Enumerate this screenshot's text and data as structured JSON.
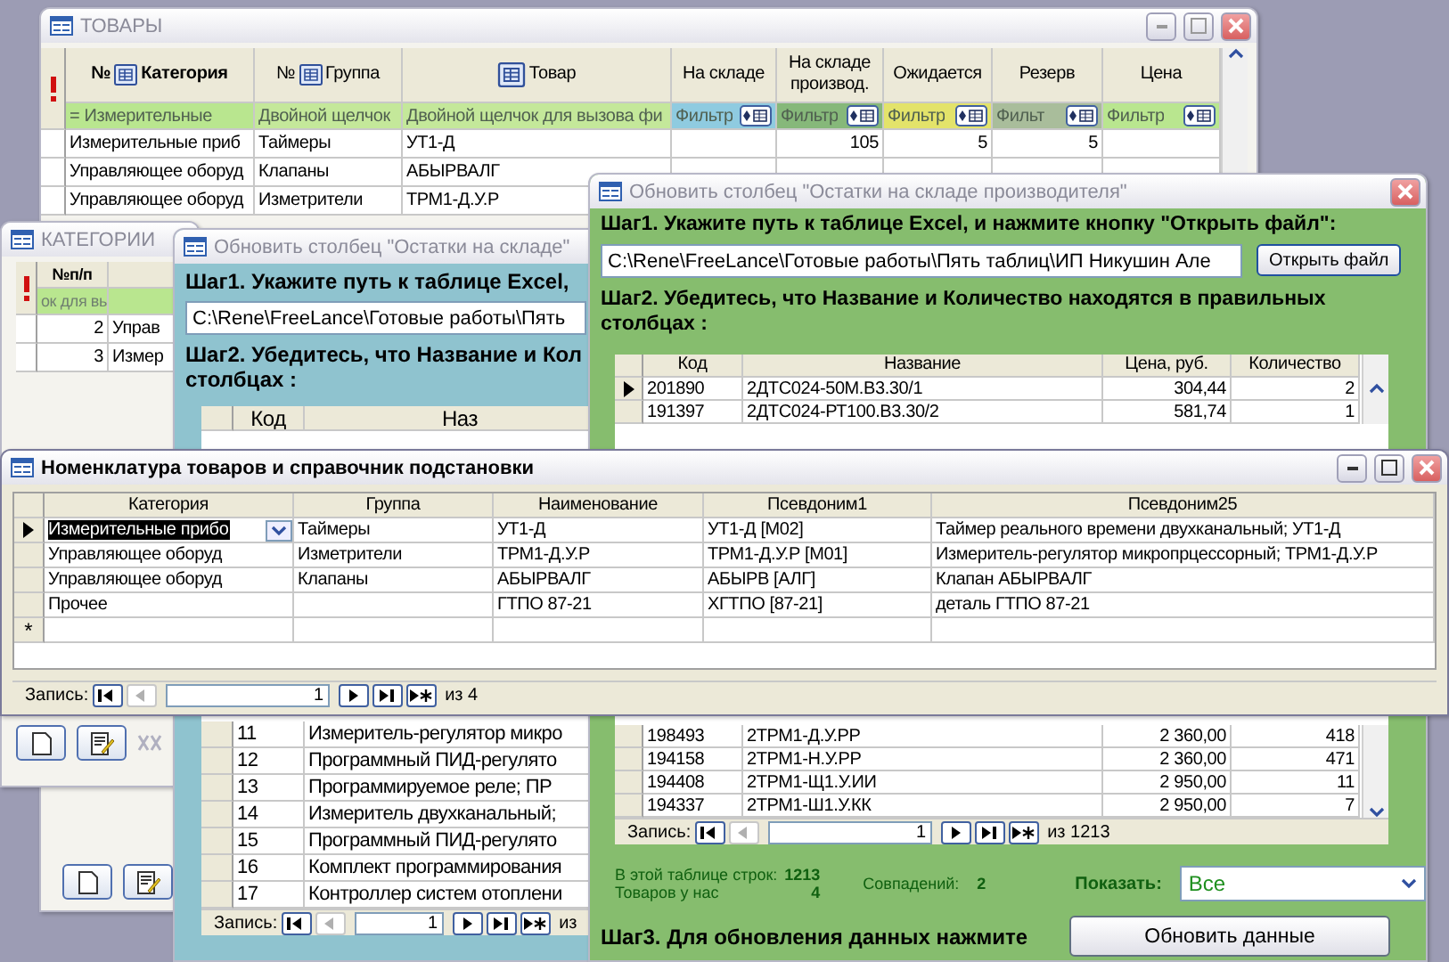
{
  "products_window": {
    "title": "ТОВАРЫ",
    "columns": [
      {
        "label": "Категория",
        "number_mark": "№",
        "bold": true,
        "filter": "= Измерительные",
        "color": "#b9e68f",
        "filter_button": false
      },
      {
        "label": "Группа",
        "number_mark": "№",
        "bold": false,
        "filter": "Двойной щелчок",
        "color": "#c4e89a",
        "filter_button": false
      },
      {
        "label": "Товар",
        "bold": false,
        "filter": "Двойной щелчок для вызова фи",
        "color": "#c4e89a",
        "filter_button": false
      },
      {
        "label": "На складе",
        "bold": false,
        "filter": "Фильтр",
        "color": "#8fcbe0",
        "filter_button": true
      },
      {
        "label": "На складе производ.",
        "bold": false,
        "filter": "Фильтр",
        "color": "#86b87a",
        "filter_button": true
      },
      {
        "label": "Ожидается",
        "bold": false,
        "filter": "Фильтр",
        "color": "#e3e36a",
        "filter_button": true
      },
      {
        "label": "Резерв",
        "bold": false,
        "filter": "Фильт",
        "color": "#a9bd9b",
        "filter_button": true
      },
      {
        "label": "Цена",
        "bold": false,
        "filter": "Фильтр",
        "color": "#b9e68f",
        "filter_button": true
      }
    ],
    "rows": [
      {
        "cells": [
          "Измерительные приб",
          "Таймеры",
          "УТ1-Д",
          null,
          "105",
          "5",
          "5",
          null
        ]
      },
      {
        "cells": [
          "Управляющее оборуд",
          "Клапаны",
          "АБЫРВАЛГ",
          null,
          null,
          null,
          null,
          null
        ]
      },
      {
        "cells": [
          "Управляющее оборуд",
          "Изметрители",
          "ТРМ1-Д.У.Р",
          null,
          null,
          null,
          null,
          null
        ]
      }
    ]
  },
  "categories_window": {
    "title": "КАТЕГОРИИ",
    "column": "№п/п",
    "filter": "ок для вь",
    "rows": [
      {
        "number": "2",
        "name": "Управ"
      },
      {
        "number": "3",
        "name": "Измер"
      }
    ]
  },
  "update_window_back": {
    "title": "Обновить столбец \"Остатки на складе\"",
    "step1": "Шаг1. Укажите путь к таблице Excel,",
    "path": "C:\\Rene\\FreeLance\\Готовые работы\\Пять",
    "step2_line1": "Шаг2. Убедитесь, что Название и Кол",
    "step2_line2": "столбцах :",
    "columns": [
      "Код",
      "Наз"
    ],
    "rows": [
      {
        "code": "11",
        "name": "Измеритель-регулятор микро"
      },
      {
        "code": "12",
        "name": "Программный ПИД-регулято"
      },
      {
        "code": "13",
        "name": "Программируемое реле; ПР"
      },
      {
        "code": "14",
        "name": "Измеритель двухканальный;"
      },
      {
        "code": "15",
        "name": "Программный ПИД-регулято"
      },
      {
        "code": "16",
        "name": "Комплект программирования"
      },
      {
        "code": "17",
        "name": "Контроллер систем отоплени"
      }
    ],
    "nav": {
      "label": "Запись:",
      "record": "1",
      "total": "из"
    }
  },
  "update_window": {
    "title": "Обновить столбец \"Остатки на складе производителя\"",
    "step1": "Шаг1. Укажите путь к таблице Excel, и нажмите кнопку \"Открыть файл\":",
    "path": "C:\\Rene\\FreeLance\\Готовые работы\\Пять таблиц\\ИП Никушин Але",
    "open_button": "Открыть файл",
    "step2": "Шаг2. Убедитесь, что Название и Количество находятся в правильных столбцах :",
    "columns": [
      "Код",
      "Название",
      "Цена, руб.",
      "Количество"
    ],
    "rows_top": [
      {
        "code": "201890",
        "name": "2ДТС024-50М.В3.30/1",
        "price": "304,44",
        "quantity": "2",
        "selected": true
      },
      {
        "code": "191397",
        "name": "2ДТС024-РТ100.В3.30/2",
        "price": "581,74",
        "quantity": "1",
        "selected": false
      }
    ],
    "rows_bottom": [
      {
        "code": "198493",
        "name": "2ТРМ1-Д.У.РР",
        "price": "2 360,00",
        "quantity": "418",
        "selected": false
      },
      {
        "code": "194158",
        "name": "2ТРМ1-Н.У.РР",
        "price": "2 360,00",
        "quantity": "471",
        "selected": false
      },
      {
        "code": "194408",
        "name": "2ТРМ1-Щ1.У.ИИ",
        "price": "2 950,00",
        "quantity": "11",
        "selected": false
      },
      {
        "code": "194337",
        "name": "2ТРМ1-Ш1.У.КК",
        "price": "2 950,00",
        "quantity": "7",
        "selected": false
      }
    ],
    "nav": {
      "label": "Запись:",
      "record": "1",
      "total": "из 1213"
    },
    "rows_label": "В этой таблице строк:",
    "rows_value": "1213",
    "ours_label": "Товаров у нас",
    "ours_value": "4",
    "matches_label": "Совпадений:",
    "matches_value": "2",
    "show_label": "Показать:",
    "show_value": "Все",
    "step3": "Шаг3. Для обновления данных нажмите",
    "update_button": "Обновить данные"
  },
  "nomenclature_window": {
    "title": "Номенклатура товаров и справочник подстановки",
    "columns": [
      "Категория",
      "Группа",
      "Наименование",
      "Псевдоним1",
      "Псевдоним25"
    ],
    "rows": [
      {
        "cells": [
          "Измерительные прибо",
          "Таймеры",
          "УТ1-Д",
          "УТ1-Д [M02]",
          "Таймер реального времени двухканальный; УТ1-Д"
        ],
        "selected": true
      },
      {
        "cells": [
          "Управляющее оборуд",
          "Изметрители",
          "ТРМ1-Д.У.Р",
          "ТРМ1-Д.У.Р [M01]",
          "Измеритель-регулятор микропрцессорный; ТРМ1-Д.У.Р"
        ],
        "selected": false
      },
      {
        "cells": [
          "Управляющее оборуд",
          "Клапаны",
          "АБЫРВАЛГ",
          "АБЫРВ [АЛГ]",
          "Клапан АБЫРВАЛГ"
        ],
        "selected": false
      },
      {
        "cells": [
          "Прочее",
          null,
          "ГТПО 87-21",
          "ХГТПО [87-21]",
          "деталь ГТПО 87-21"
        ],
        "selected": false
      }
    ],
    "new_row_marker": "*",
    "nav": {
      "label": "Запись:",
      "record": "1",
      "total": "из 4"
    }
  }
}
